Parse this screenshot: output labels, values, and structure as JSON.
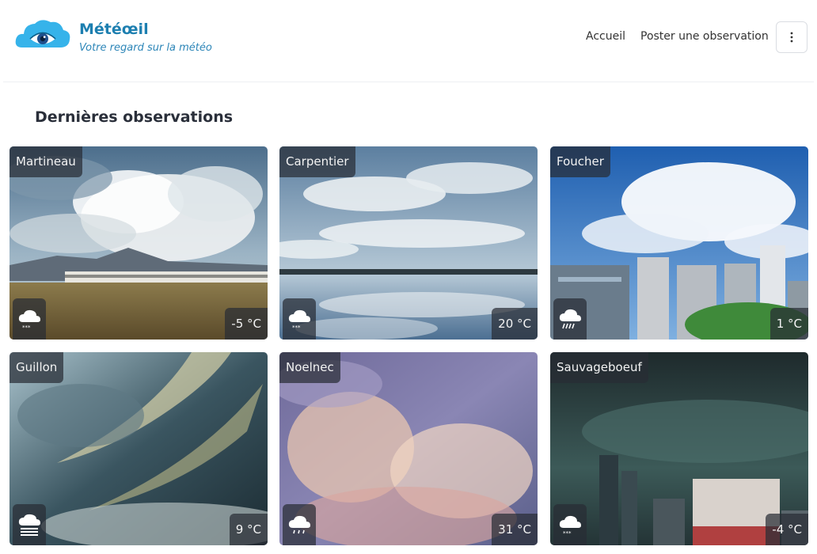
{
  "brand": {
    "name": "Météœil",
    "tagline": "Votre regard sur la météo",
    "color": "#1d7fb0"
  },
  "nav": {
    "home": "Accueil",
    "post": "Poster une observation",
    "menu_icon": "more-vertical-icon"
  },
  "section": {
    "title": "Dernières observations"
  },
  "observations": [
    {
      "city": "Martineau",
      "temperature": "-5 °C",
      "weather_icon": "snow-icon"
    },
    {
      "city": "Carpentier",
      "temperature": "20 °C",
      "weather_icon": "snow-icon"
    },
    {
      "city": "Foucher",
      "temperature": "1 °C",
      "weather_icon": "heavy-rain-icon"
    },
    {
      "city": "Guillon",
      "temperature": "9 °C",
      "weather_icon": "fog-icon"
    },
    {
      "city": "Noelnec",
      "temperature": "31 °C",
      "weather_icon": "rain-icon"
    },
    {
      "city": "Sauvageboeuf",
      "temperature": "-4 °C",
      "weather_icon": "snow-icon"
    }
  ]
}
